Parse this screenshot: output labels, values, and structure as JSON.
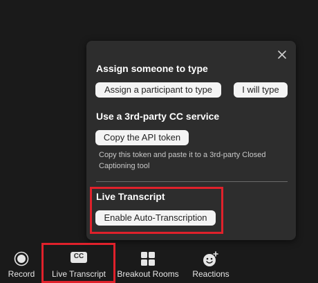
{
  "captions_panel": {
    "assign_heading": "Assign someone to type",
    "assign_participant_label": "Assign a participant to type",
    "i_will_type_label": "I will type",
    "third_party_heading": "Use a 3rd-party CC service",
    "copy_token_label": "Copy the API token",
    "token_hint": "Copy this token and paste it to a 3rd-party Closed Captioning tool",
    "live_transcript_heading": "Live Transcript",
    "enable_auto_label": "Enable Auto-Transcription"
  },
  "toolbar": {
    "record_label": "Record",
    "live_transcript_label": "Live Transcript",
    "cc_icon_text": "CC",
    "breakout_label": "Breakout Rooms",
    "reactions_label": "Reactions"
  },
  "colors": {
    "background": "#1a1a1a",
    "panel": "#2d2d2d",
    "highlight": "#e0212b",
    "button": "#f4f4f4"
  },
  "icons": {
    "close": "close-icon",
    "record": "record-icon",
    "cc": "cc-icon",
    "breakout": "breakout-rooms-icon",
    "reactions": "reactions-icon"
  }
}
